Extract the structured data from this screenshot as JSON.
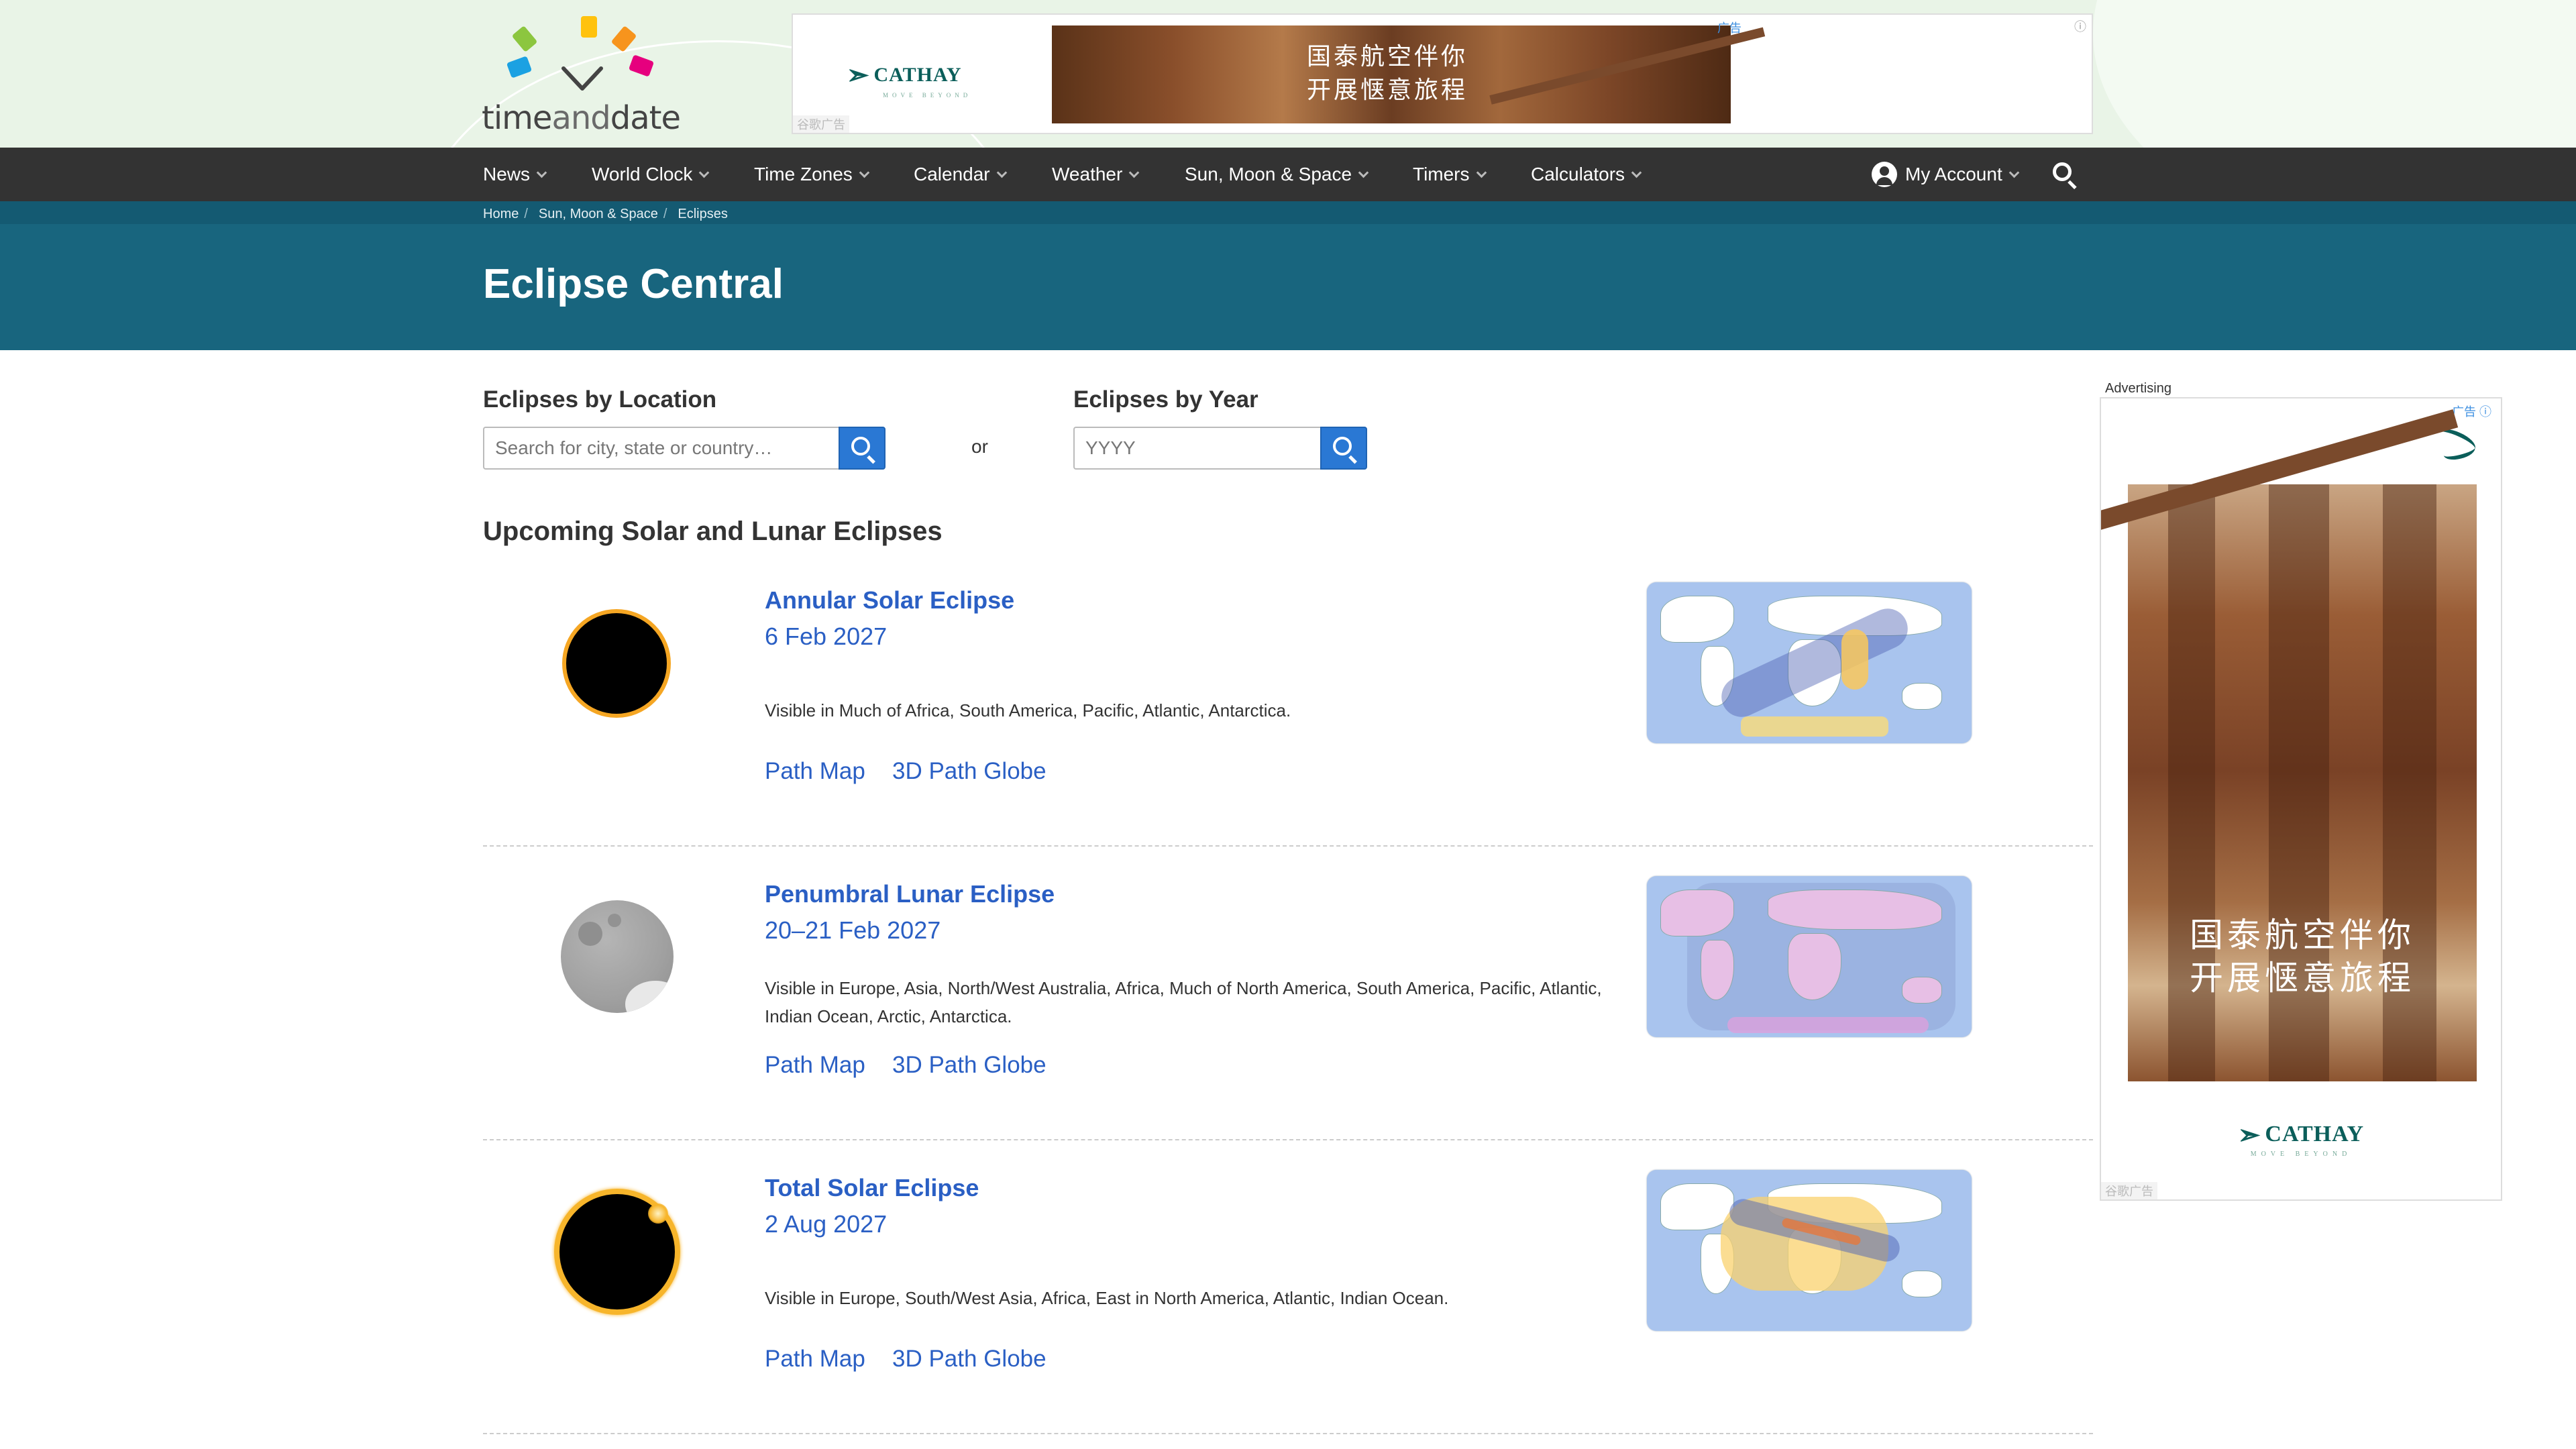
{
  "header": {
    "logo_text_a": "time",
    "logo_text_b": "and",
    "logo_text_c": "date",
    "ad": {
      "brand": "CATHAY",
      "tagline": "MOVE BEYOND",
      "slogan_line1": "国泰航空伴你",
      "slogan_line2": "开展惬意旅程",
      "label": "谷歌广告",
      "tag": "广告"
    }
  },
  "nav": {
    "items": [
      {
        "label": "News"
      },
      {
        "label": "World Clock"
      },
      {
        "label": "Time Zones"
      },
      {
        "label": "Calendar"
      },
      {
        "label": "Weather"
      },
      {
        "label": "Sun, Moon & Space"
      },
      {
        "label": "Timers"
      },
      {
        "label": "Calculators"
      }
    ],
    "account_label": "My Account"
  },
  "breadcrumb": {
    "items": [
      "Home",
      "Sun, Moon & Space",
      "Eclipses"
    ]
  },
  "page": {
    "title": "Eclipse Central"
  },
  "search": {
    "location_label": "Eclipses by Location",
    "location_placeholder": "Search for city, state or country…",
    "or_text": "or",
    "year_label": "Eclipses by Year",
    "year_placeholder": "YYYY"
  },
  "upcoming": {
    "heading": "Upcoming Solar and Lunar Eclipses",
    "eclipses": [
      {
        "title": "Annular Solar Eclipse",
        "date": "6 Feb 2027",
        "visibility": "Visible in Much of Africa, South America, Pacific, Atlantic, Antarctica.",
        "path_map": "Path Map",
        "globe": "3D Path Globe"
      },
      {
        "title": "Penumbral Lunar Eclipse",
        "date": "20–21 Feb 2027",
        "visibility": "Visible in Europe, Asia, North/West Australia, Africa, Much of North America, South America, Pacific, Atlantic, Indian Ocean, Arctic, Antarctica.",
        "path_map": "Path Map",
        "globe": "3D Path Globe"
      },
      {
        "title": "Total Solar Eclipse",
        "date": "2 Aug 2027",
        "visibility": "Visible in Europe, South/West Asia, Africa, East in North America, Atlantic, Indian Ocean.",
        "path_map": "Path Map",
        "globe": "3D Path Globe"
      }
    ]
  },
  "side_ad": {
    "advertising_label": "Advertising",
    "tag": "广告",
    "slogan_line1": "国泰航空伴你",
    "slogan_line2": "开展惬意旅程",
    "brand": "CATHAY",
    "tagline": "MOVE BEYOND",
    "label": "谷歌广告"
  },
  "colors": {
    "nav_bg": "#333333",
    "hero_bg": "#18657e",
    "link": "#2a5fc4",
    "search_button": "#2a78d4"
  }
}
